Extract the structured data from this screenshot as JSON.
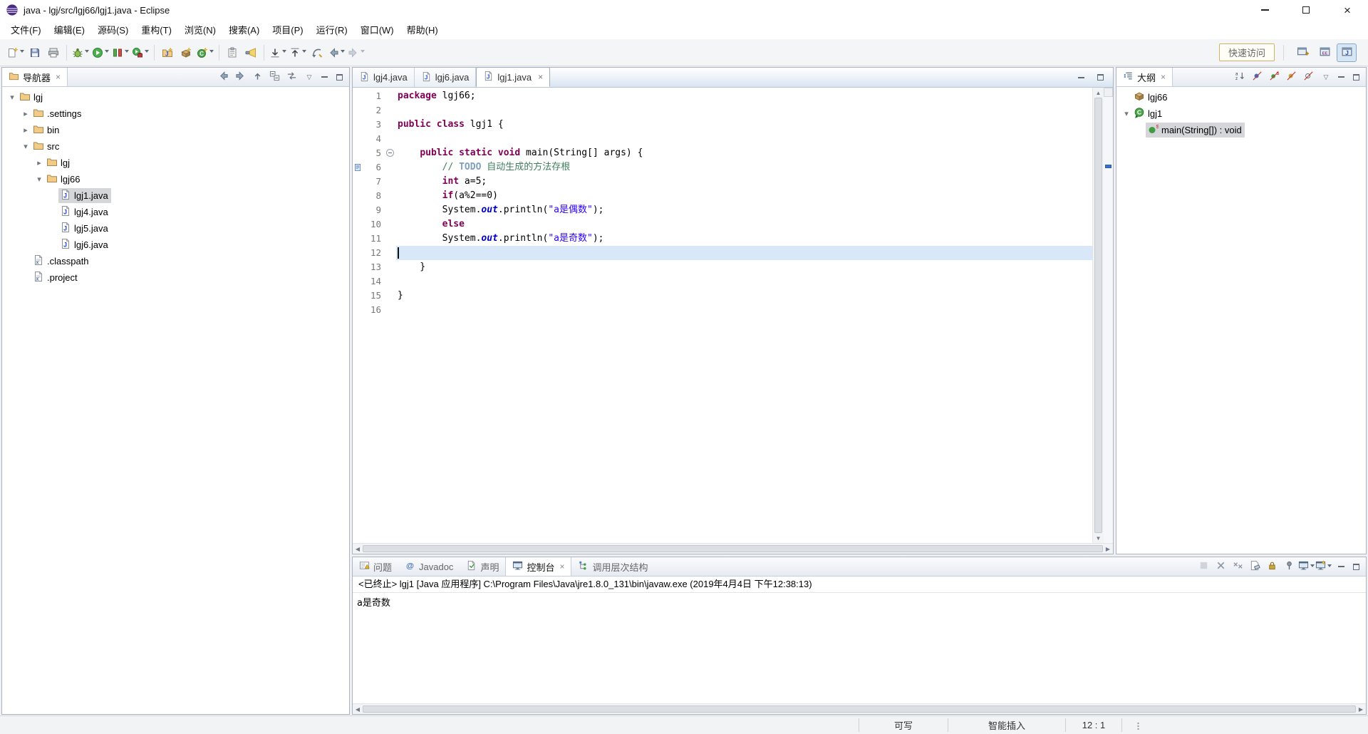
{
  "window": {
    "title": "java - lgj/src/lgj66/lgj1.java - Eclipse"
  },
  "colors": {
    "keyword": "#7F0055",
    "string": "#2A00FF",
    "comment": "#3F7F5F",
    "todo_tag": "#7F9FBF",
    "static_field": "#0000C0",
    "line_number": "#787878",
    "current_line": "#D9E8F8",
    "selection_inactive": "#D4D6D9",
    "overview_marker": "#3A6FD8"
  },
  "menu": {
    "items": [
      {
        "name": "file",
        "label": "文件(F)"
      },
      {
        "name": "edit",
        "label": "编辑(E)"
      },
      {
        "name": "source",
        "label": "源码(S)"
      },
      {
        "name": "refactor",
        "label": "重构(T)"
      },
      {
        "name": "navigate",
        "label": "浏览(N)"
      },
      {
        "name": "search",
        "label": "搜索(A)"
      },
      {
        "name": "project",
        "label": "项目(P)"
      },
      {
        "name": "run",
        "label": "运行(R)"
      },
      {
        "name": "window",
        "label": "窗口(W)"
      },
      {
        "name": "help",
        "label": "帮助(H)"
      }
    ]
  },
  "toolbar": {
    "quick_access_label": "快速访问",
    "items": [
      {
        "type": "button",
        "name": "new-wizard",
        "icon": "new-wizard",
        "dropdown": true
      },
      {
        "type": "button",
        "name": "save",
        "icon": "save"
      },
      {
        "type": "button",
        "name": "print",
        "icon": "print"
      },
      {
        "type": "sep"
      },
      {
        "type": "button",
        "name": "debug",
        "icon": "debug",
        "dropdown": true
      },
      {
        "type": "button",
        "name": "run",
        "icon": "run",
        "dropdown": true
      },
      {
        "type": "button",
        "name": "coverage",
        "icon": "coverage",
        "dropdown": true
      },
      {
        "type": "button",
        "name": "run-external-tools",
        "icon": "external-tools",
        "dropdown": true
      },
      {
        "type": "sep"
      },
      {
        "type": "button",
        "name": "new-java-project",
        "icon": "new-java-project"
      },
      {
        "type": "button",
        "name": "new-package",
        "icon": "new-package"
      },
      {
        "type": "button",
        "name": "new-class",
        "icon": "new-class",
        "dropdown": true
      },
      {
        "type": "sep"
      },
      {
        "type": "button",
        "name": "open-task",
        "icon": "open-task"
      },
      {
        "type": "button",
        "name": "search-dialog",
        "icon": "search"
      },
      {
        "type": "sep"
      },
      {
        "type": "button",
        "name": "next-annotation",
        "icon": "next-annotation",
        "dropdown": true
      },
      {
        "type": "button",
        "name": "previous-annotation",
        "icon": "prev-annotation",
        "dropdown": true
      },
      {
        "type": "button",
        "name": "last-edit-location",
        "icon": "last-edit"
      },
      {
        "type": "button",
        "name": "back-history",
        "icon": "back-nav",
        "dropdown": true
      },
      {
        "type": "button",
        "name": "forward-history",
        "icon": "forward-nav",
        "dropdown": true,
        "disabled": true
      }
    ],
    "perspectives": [
      {
        "name": "open-perspective",
        "icon": "open-perspective"
      },
      {
        "name": "perspective-javaee",
        "icon": "perspective-javaee"
      },
      {
        "name": "perspective-java",
        "icon": "perspective-java",
        "active": true
      }
    ]
  },
  "navigator": {
    "title": "导航器",
    "toolbar": [
      {
        "name": "back",
        "icon": "back-nav"
      },
      {
        "name": "forward",
        "icon": "forward-nav"
      },
      {
        "name": "up",
        "icon": "nav-up"
      },
      {
        "name": "collapse-all",
        "icon": "collapse-all"
      },
      {
        "name": "link-with-editor",
        "icon": "link-editor"
      }
    ],
    "tree": [
      {
        "name": "project-lgj",
        "label": "lgj",
        "level": 0,
        "icon": "folder",
        "arrow": "expanded"
      },
      {
        "name": "folder-settings",
        "label": ".settings",
        "level": 1,
        "icon": "folder",
        "arrow": "collapsed"
      },
      {
        "name": "folder-bin",
        "label": "bin",
        "level": 1,
        "icon": "folder",
        "arrow": "collapsed"
      },
      {
        "name": "folder-src",
        "label": "src",
        "level": 1,
        "icon": "folder",
        "arrow": "expanded"
      },
      {
        "name": "folder-lgj",
        "label": "lgj",
        "level": 2,
        "icon": "folder",
        "arrow": "collapsed"
      },
      {
        "name": "folder-lgj66",
        "label": "lgj66",
        "level": 2,
        "icon": "folder",
        "arrow": "expanded"
      },
      {
        "name": "file-lgj1-java",
        "label": "lgj1.java",
        "level": 3,
        "icon": "java-file",
        "selected": true
      },
      {
        "name": "file-lgj4-java",
        "label": "lgj4.java",
        "level": 3,
        "icon": "java-file"
      },
      {
        "name": "file-lgj5-java",
        "label": "lgj5.java",
        "level": 3,
        "icon": "java-file"
      },
      {
        "name": "file-lgj6-java",
        "label": "lgj6.java",
        "level": 3,
        "icon": "java-file"
      },
      {
        "name": "file-classpath",
        "label": ".classpath",
        "level": 1,
        "icon": "config-file"
      },
      {
        "name": "file-project",
        "label": ".project",
        "level": 1,
        "icon": "config-file"
      }
    ]
  },
  "editor": {
    "tabs": [
      {
        "name": "tab-lgj4-java",
        "label": "lgj4.java",
        "icon": "java-file"
      },
      {
        "name": "tab-lgj6-java",
        "label": "lgj6.java",
        "icon": "java-file"
      },
      {
        "name": "tab-lgj1-java",
        "label": "lgj1.java",
        "icon": "java-file",
        "active": true
      }
    ],
    "current_line": 12,
    "fold_lines": [
      5
    ],
    "task_marker_lines": [
      6
    ],
    "overview_marks": [
      {
        "line": 6
      }
    ],
    "code": {
      "lines": [
        {
          "num": 1,
          "tokens": [
            {
              "t": "package",
              "s": "kw"
            },
            {
              "t": " lgj66;",
              "s": "pl"
            }
          ]
        },
        {
          "num": 2,
          "tokens": []
        },
        {
          "num": 3,
          "tokens": [
            {
              "t": "public",
              "s": "kw"
            },
            {
              "t": " ",
              "s": "pl"
            },
            {
              "t": "class",
              "s": "kw"
            },
            {
              "t": " lgj1 {",
              "s": "pl"
            }
          ]
        },
        {
          "num": 4,
          "tokens": []
        },
        {
          "num": 5,
          "tokens": [
            {
              "t": "    ",
              "s": "pl"
            },
            {
              "t": "public",
              "s": "kw"
            },
            {
              "t": " ",
              "s": "pl"
            },
            {
              "t": "static",
              "s": "kw"
            },
            {
              "t": " ",
              "s": "pl"
            },
            {
              "t": "void",
              "s": "kw"
            },
            {
              "t": " main(String[] args) {",
              "s": "pl"
            }
          ]
        },
        {
          "num": 6,
          "tokens": [
            {
              "t": "        ",
              "s": "pl"
            },
            {
              "t": "// ",
              "s": "cm"
            },
            {
              "t": "TODO",
              "s": "todo"
            },
            {
              "t": " 自动生成的方法存根",
              "s": "cm"
            }
          ]
        },
        {
          "num": 7,
          "tokens": [
            {
              "t": "        ",
              "s": "pl"
            },
            {
              "t": "int",
              "s": "kw"
            },
            {
              "t": " a=5;",
              "s": "pl"
            }
          ]
        },
        {
          "num": 8,
          "tokens": [
            {
              "t": "        ",
              "s": "pl"
            },
            {
              "t": "if",
              "s": "kw"
            },
            {
              "t": "(a%2==0)",
              "s": "pl"
            }
          ]
        },
        {
          "num": 9,
          "tokens": [
            {
              "t": "        System.",
              "s": "pl"
            },
            {
              "t": "out",
              "s": "fld"
            },
            {
              "t": ".println(",
              "s": "pl"
            },
            {
              "t": "\"a是偶数\"",
              "s": "str"
            },
            {
              "t": ");",
              "s": "pl"
            }
          ]
        },
        {
          "num": 10,
          "tokens": [
            {
              "t": "        ",
              "s": "pl"
            },
            {
              "t": "else",
              "s": "kw"
            }
          ]
        },
        {
          "num": 11,
          "tokens": [
            {
              "t": "        System.",
              "s": "pl"
            },
            {
              "t": "out",
              "s": "fld"
            },
            {
              "t": ".println(",
              "s": "pl"
            },
            {
              "t": "\"a是奇数\"",
              "s": "str"
            },
            {
              "t": ");",
              "s": "pl"
            }
          ]
        },
        {
          "num": 12,
          "tokens": []
        },
        {
          "num": 13,
          "tokens": [
            {
              "t": "    }",
              "s": "pl"
            }
          ]
        },
        {
          "num": 14,
          "tokens": []
        },
        {
          "num": 15,
          "tokens": [
            {
              "t": "}",
              "s": "pl"
            }
          ]
        },
        {
          "num": 16,
          "tokens": []
        }
      ]
    }
  },
  "outline": {
    "title": "大纲",
    "toolbar": [
      {
        "name": "sort",
        "icon": "sort"
      },
      {
        "name": "hide-fields",
        "icon": "hide-fields"
      },
      {
        "name": "hide-static-members",
        "icon": "hide-static"
      },
      {
        "name": "hide-non-public-members",
        "icon": "hide-nonpublic"
      },
      {
        "name": "hide-local-types",
        "icon": "hide-local"
      }
    ],
    "items": [
      {
        "name": "outline-package-lgj66",
        "label": "lgj66",
        "level": 0,
        "icon": "package"
      },
      {
        "name": "outline-class-lgj1",
        "label": "lgj1",
        "level": 0,
        "icon": "class-run",
        "arrow": "expanded"
      },
      {
        "name": "outline-method-main",
        "label": "main(String[]) : void",
        "level": 1,
        "icon": "method-static",
        "selected": true
      }
    ]
  },
  "console": {
    "tabs": [
      {
        "name": "tab-problems",
        "label": "问题",
        "icon": "problems-view"
      },
      {
        "name": "tab-javadoc",
        "label": "Javadoc",
        "icon": "javadoc-view"
      },
      {
        "name": "tab-declaration",
        "label": "声明",
        "icon": "declaration-view"
      },
      {
        "name": "tab-console",
        "label": "控制台",
        "icon": "console-view",
        "active": true
      },
      {
        "name": "tab-call-hierarchy",
        "label": "调用层次结构",
        "icon": "callhierarchy-view"
      }
    ],
    "toolbar": [
      {
        "name": "terminate",
        "icon": "terminate",
        "disabled": true
      },
      {
        "name": "remove-launch",
        "icon": "remove-launch"
      },
      {
        "name": "remove-all-launches",
        "icon": "remove-all"
      },
      {
        "name": "clear-console",
        "icon": "clear-console"
      },
      {
        "name": "scroll-lock",
        "icon": "scroll-lock"
      },
      {
        "name": "pin-console",
        "icon": "pin-console"
      },
      {
        "name": "display-selected-console",
        "icon": "console-display",
        "dropdown": true
      },
      {
        "name": "open-console",
        "icon": "open-console",
        "dropdown": true
      }
    ],
    "header": "<已终止> lgj1 [Java 应用程序] C:\\Program Files\\Java\\jre1.8.0_131\\bin\\javaw.exe  (2019年4月4日 下午12:38:13)",
    "output": "a是奇数"
  },
  "statusbar": {
    "writable": "可写",
    "input_mode": "智能插入",
    "caret_position": "12 : 1"
  }
}
